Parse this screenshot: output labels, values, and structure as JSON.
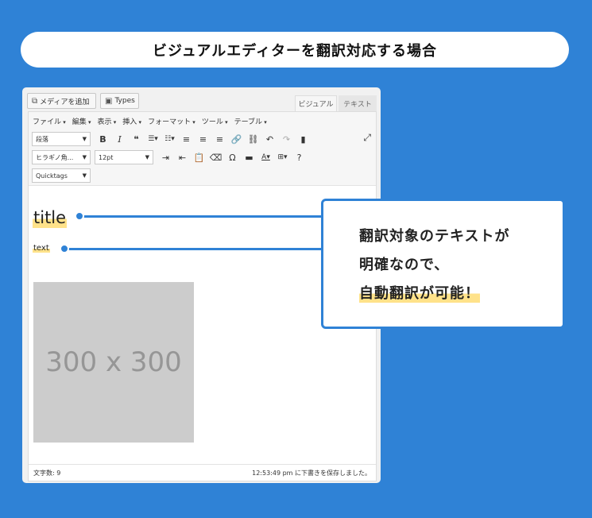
{
  "banner": {
    "title": "ビジュアルエディターを翻訳対応する場合"
  },
  "editor": {
    "add_media": "メディアを追加",
    "types": "Types",
    "tab_visual": "ビジュアル",
    "tab_text": "テキスト",
    "menubar": [
      "ファイル",
      "編集",
      "表示",
      "挿入",
      "フォーマット",
      "ツール",
      "テーブル"
    ],
    "format_select": "段落",
    "font_select": "ヒラギノ角...",
    "size_select": "12pt",
    "quicktags_select": "Quicktags",
    "content_title": "title",
    "content_text": "text",
    "image_placeholder": "300 x 300",
    "word_count": "文字数: 9",
    "saved_status": "12:53:49 pm に下書きを保存しました。"
  },
  "callout": {
    "line1": "翻訳対象のテキストが",
    "line2": "明確なので、",
    "line3": "自動翻訳が可能！"
  },
  "icons": [
    "media-icon",
    "types-icon",
    "bold-icon",
    "italic-icon",
    "quote-icon",
    "bullet-list-icon",
    "numbered-list-icon",
    "align-left-icon",
    "align-center-icon",
    "align-right-icon",
    "link-icon",
    "unlink-icon",
    "undo-icon",
    "redo-icon",
    "chart-icon",
    "expand-icon",
    "indent-icon",
    "outdent-icon",
    "paste-icon",
    "clear-format-icon",
    "omega-icon",
    "hr-icon",
    "text-color-icon",
    "table-icon",
    "help-icon"
  ]
}
